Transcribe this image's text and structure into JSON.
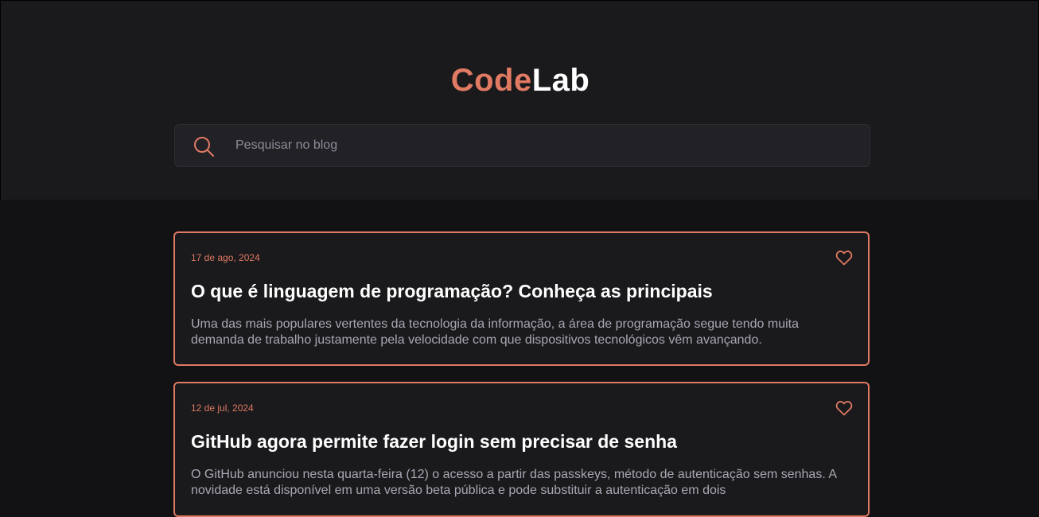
{
  "header": {
    "logo_part1": "Code",
    "logo_part2": "Lab"
  },
  "search": {
    "placeholder": "Pesquisar no blog",
    "icon": "search-icon"
  },
  "colors": {
    "accent": "#e07a63",
    "background": "#121214",
    "header_bg": "#1a191c",
    "card_bg": "#1a191c",
    "title": "#ffffff",
    "body_text": "#a8a8b3"
  },
  "posts": [
    {
      "date": "17 de ago, 2024",
      "title": "O que é linguagem de programação? Conheça as principais",
      "excerpt": "Uma das mais populares vertentes da tecnologia da informação, a área de programação segue tendo muita demanda de trabalho justamente pela velocidade com que dispositivos tecnológicos vêm avançando.",
      "icon": "heart-icon"
    },
    {
      "date": "12 de jul, 2024",
      "title": "GitHub agora permite fazer login sem precisar de senha",
      "excerpt": "O GitHub anunciou nesta quarta-feira (12) o acesso a partir das passkeys, método de autenticação sem senhas. A novidade está disponível em uma versão beta pública e pode substituir a autenticação em dois",
      "icon": "heart-icon"
    }
  ]
}
